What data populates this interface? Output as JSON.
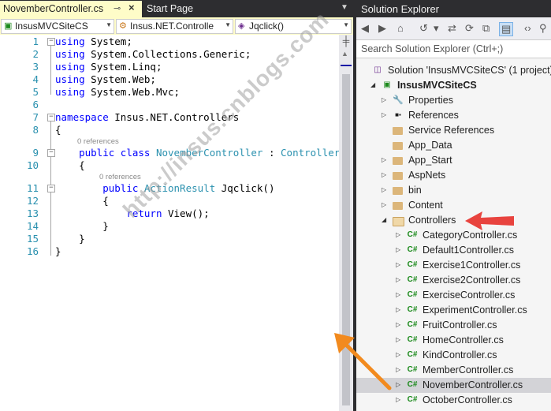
{
  "editor": {
    "active_tab": "NovemberController.cs",
    "active_tab_pin": "⊸",
    "active_tab_close": "×",
    "inactive_tab": "Start Page",
    "nav": {
      "project": "InsusMVCSiteCS",
      "class": "Insus.NET.Controlle",
      "member": "Jqclick()"
    },
    "lines": [
      {
        "n": "1",
        "code": [
          {
            "k": "kw",
            "t": "using"
          },
          {
            "t": " System;"
          }
        ]
      },
      {
        "n": "2",
        "code": [
          {
            "k": "kw",
            "t": "using"
          },
          {
            "t": " System.Collections.Generic;"
          }
        ]
      },
      {
        "n": "3",
        "code": [
          {
            "k": "kw",
            "t": "using"
          },
          {
            "t": " System.Linq;"
          }
        ]
      },
      {
        "n": "4",
        "code": [
          {
            "k": "kw",
            "t": "using"
          },
          {
            "t": " System.Web;"
          }
        ]
      },
      {
        "n": "5",
        "code": [
          {
            "k": "kw",
            "t": "using"
          },
          {
            "t": " System.Web.Mvc;"
          }
        ]
      },
      {
        "n": "6",
        "code": []
      },
      {
        "n": "7",
        "code": [
          {
            "k": "kw",
            "t": "namespace"
          },
          {
            "t": " Insus.NET.Controllers"
          }
        ]
      },
      {
        "n": "8",
        "code": [
          {
            "t": "{"
          }
        ]
      },
      {
        "n": "9",
        "code": [
          {
            "t": "    "
          },
          {
            "k": "kw",
            "t": "public"
          },
          {
            "t": " "
          },
          {
            "k": "kw",
            "t": "class"
          },
          {
            "t": " "
          },
          {
            "k": "ty",
            "t": "NovemberController"
          },
          {
            "t": " : "
          },
          {
            "k": "ty",
            "t": "Controller"
          }
        ]
      },
      {
        "n": "10",
        "code": [
          {
            "t": "    {"
          }
        ]
      },
      {
        "n": "11",
        "code": [
          {
            "t": "        "
          },
          {
            "k": "kw",
            "t": "public"
          },
          {
            "t": " "
          },
          {
            "k": "ty",
            "t": "ActionResult"
          },
          {
            "t": " Jqclick()"
          }
        ]
      },
      {
        "n": "12",
        "code": [
          {
            "t": "        {"
          }
        ]
      },
      {
        "n": "13",
        "code": [
          {
            "t": "            "
          },
          {
            "k": "kw",
            "t": "return"
          },
          {
            "t": " View();"
          }
        ]
      },
      {
        "n": "14",
        "code": [
          {
            "t": "        }"
          }
        ]
      },
      {
        "n": "15",
        "code": [
          {
            "t": "    }"
          }
        ]
      },
      {
        "n": "16",
        "code": [
          {
            "t": "}"
          }
        ]
      }
    ],
    "references_9": "0 references",
    "references_11": "0 references"
  },
  "watermark": "http://insus.cnblogs.com",
  "solution_explorer": {
    "title": "Solution Explorer",
    "search_placeholder": "Search Solution Explorer (Ctrl+;)",
    "tree": [
      {
        "label": "Solution 'InsusMVCSiteCS' (1 project)",
        "level": 0,
        "icon": "solution-icon",
        "expander": "none"
      },
      {
        "label": "InsusMVCSiteCS",
        "level": 1,
        "icon": "project-icon",
        "expander": "open",
        "bold": true
      },
      {
        "label": "Properties",
        "level": 2,
        "icon": "wrench-icon",
        "expander": "closed"
      },
      {
        "label": "References",
        "level": 2,
        "icon": "references-icon",
        "expander": "closed"
      },
      {
        "label": "Service References",
        "level": 2,
        "icon": "folder-icon",
        "expander": "none"
      },
      {
        "label": "App_Data",
        "level": 2,
        "icon": "folder-icon",
        "expander": "none"
      },
      {
        "label": "App_Start",
        "level": 2,
        "icon": "folder-icon",
        "expander": "closed"
      },
      {
        "label": "AspNets",
        "level": 2,
        "icon": "folder-icon",
        "expander": "closed"
      },
      {
        "label": "bin",
        "level": 2,
        "icon": "folder-icon",
        "expander": "closed"
      },
      {
        "label": "Content",
        "level": 2,
        "icon": "folder-icon",
        "expander": "closed"
      },
      {
        "label": "Controllers",
        "level": 2,
        "icon": "folder-open-icon",
        "expander": "open"
      },
      {
        "label": "CategoryController.cs",
        "level": 3,
        "icon": "csharp-file-icon",
        "expander": "closed"
      },
      {
        "label": "Default1Controller.cs",
        "level": 3,
        "icon": "csharp-file-icon",
        "expander": "closed"
      },
      {
        "label": "Exercise1Controller.cs",
        "level": 3,
        "icon": "csharp-file-icon",
        "expander": "closed"
      },
      {
        "label": "Exercise2Controller.cs",
        "level": 3,
        "icon": "csharp-file-icon",
        "expander": "closed"
      },
      {
        "label": "ExerciseController.cs",
        "level": 3,
        "icon": "csharp-file-icon",
        "expander": "closed"
      },
      {
        "label": "ExperimentController.cs",
        "level": 3,
        "icon": "csharp-file-icon",
        "expander": "closed"
      },
      {
        "label": "FruitController.cs",
        "level": 3,
        "icon": "csharp-file-icon",
        "expander": "closed"
      },
      {
        "label": "HomeController.cs",
        "level": 3,
        "icon": "csharp-file-icon",
        "expander": "closed"
      },
      {
        "label": "KindController.cs",
        "level": 3,
        "icon": "csharp-file-icon",
        "expander": "closed"
      },
      {
        "label": "MemberController.cs",
        "level": 3,
        "icon": "csharp-file-icon",
        "expander": "closed"
      },
      {
        "label": "NovemberController.cs",
        "level": 3,
        "icon": "csharp-file-icon",
        "expander": "closed",
        "selected": true
      },
      {
        "label": "OctoberController.cs",
        "level": 3,
        "icon": "csharp-file-icon",
        "expander": "closed"
      }
    ],
    "colors": {
      "folder": "#dcb67a",
      "csharp": "#1b8a1b",
      "selection": "#d3d3d7"
    }
  },
  "annotation_colors": {
    "red_arrow": "#e8433e",
    "orange_arrow": "#f28a1e"
  }
}
